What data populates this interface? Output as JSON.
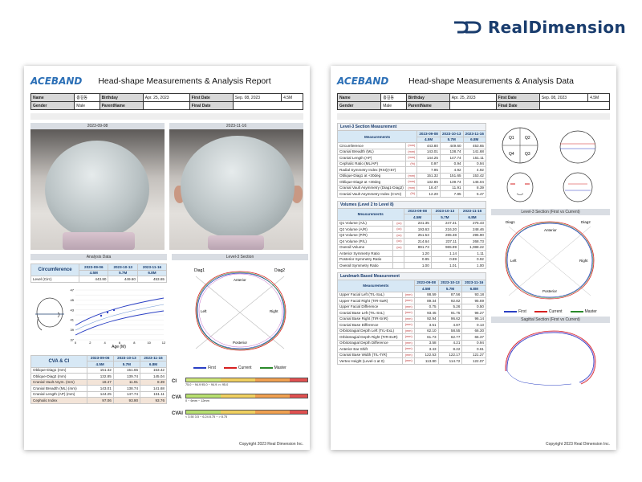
{
  "brand": {
    "name": "RealDimension",
    "accent": "#1a3d6e"
  },
  "left": {
    "logo": "ACEBAND",
    "title": "Head-shape Measurements & Analysis Report",
    "info": {
      "name_label": "Name",
      "name": "홍길동",
      "birthday_label": "Birthday",
      "birthday": "Apr. 25, 2023",
      "first_date_label": "First Date",
      "first_date": "Sep. 08, 2023",
      "age": "4.5M",
      "gender_label": "Gender",
      "gender": "Male",
      "parent_label": "ParentName",
      "final_label": "Final Date"
    },
    "photo_dates": [
      "2023-09-08",
      "2023-11-16"
    ],
    "analysis_label": "Analysis Data",
    "level3_label": "Level-3 Section",
    "circ": {
      "title": "Circumference",
      "dates": [
        "2023-09-06",
        "2023-10-13",
        "2023-11-16"
      ],
      "ages": [
        "4.5M",
        "5.7M",
        "6.8M"
      ],
      "row_label": "Level (Circ)",
      "values": [
        "443.80",
        "449.60",
        "453.65"
      ]
    },
    "growth": {
      "xlabel": "Age (M)",
      "yticks": [
        "47",
        "46",
        "45",
        "44",
        "43",
        "42",
        "41",
        "40",
        "39",
        "38",
        "37"
      ],
      "xticks": [
        "0",
        "2",
        "4",
        "6",
        "8",
        "10",
        "12"
      ]
    },
    "cva": {
      "title": "CVA & CI",
      "dates": [
        "2023-09-06",
        "2023-10-13",
        "2023-11-16"
      ],
      "ages": [
        "4.5M",
        "5.7M",
        "6.8M"
      ],
      "rows": [
        {
          "name": "Oblique-Diag1 (mm)",
          "v": [
            "151.32",
            "151.65",
            "153.42"
          ]
        },
        {
          "name": "Oblique-Diag2 (mm)",
          "v": [
            "132.85",
            "139.74",
            "145.04"
          ]
        },
        {
          "name": "Cranial Vault Asym. (mm)",
          "v": [
            "18.47",
            "11.91",
            "8.39"
          ],
          "hl": true
        },
        {
          "name": "Cranial Breadth (ML) (mm)",
          "v": [
            "143.01",
            "138.74",
            "141.68"
          ]
        },
        {
          "name": "Cranial Length (AP) (mm)",
          "v": [
            "144.25",
            "147.74",
            "151.11"
          ]
        },
        {
          "name": "Cephalic Index",
          "v": [
            "97.06",
            "93.90",
            "93.76"
          ],
          "hl": true
        }
      ]
    },
    "legend": [
      {
        "label": "First",
        "color": "#2a3fc4"
      },
      {
        "label": "Current",
        "color": "#d62020"
      },
      {
        "label": "Master",
        "color": "#2a8a2a"
      }
    ],
    "orient": {
      "d1": "Diag1",
      "d2": "Diag2",
      "ant": "Anterior",
      "post": "Posterior",
      "l": "Left",
      "r": "Right"
    },
    "scales": [
      {
        "label": "CI",
        "range_text": "75.0 ~ 94.9     95.0 ~ 94.9     >= 95.0"
      },
      {
        "label": "CVA",
        "range_text": "0 ~ 6mm     ~ 12mm"
      },
      {
        "label": "CVAI",
        "range_text": "< 3.50     3.5 ~ 6.24     8.75 ~     > 8.75"
      }
    ],
    "copyright": "Copyright 2023 Real Dimension Inc."
  },
  "right": {
    "logo": "ACEBAND",
    "title": "Head-shape Measurements & Analysis Data",
    "info": {
      "name_label": "Name",
      "name": "홍길동",
      "birthday_label": "Birthday",
      "birthday": "Apr. 25, 2023",
      "first_date_label": "First Date",
      "first_date": "Sep. 08, 2023",
      "age": "4.5M",
      "gender_label": "Gender",
      "gender": "Male",
      "parent_label": "ParentName",
      "final_label": "Final Date"
    },
    "meas_label": "Measurements",
    "dates": [
      "2023-09-08",
      "2023-10-13",
      "2023-11-16"
    ],
    "ages": [
      "4.5M",
      "5.7M",
      "6.8M"
    ],
    "sec1": {
      "title": "Level-3 Section Measurement",
      "rows": [
        {
          "n": "Circumference",
          "u": "(mm)",
          "v": [
            "443.80",
            "449.60",
            "453.65"
          ]
        },
        {
          "n": "Cranial Breadth (ML)",
          "u": "(mm)",
          "v": [
            "143.01",
            "138.74",
            "141.68"
          ]
        },
        {
          "n": "Cranial Length (AP)",
          "u": "(mm)",
          "v": [
            "144.25",
            "147.74",
            "151.11"
          ]
        },
        {
          "n": "Cephalic Ratio (ML/AP)",
          "u": "(%)",
          "v": [
            "0.97",
            "0.94",
            "0.94"
          ]
        },
        {
          "n": "Radial Symmetry Index (RSI)(<57)",
          "u": "",
          "v": [
            "7.95",
            "4.92",
            "4.92"
          ]
        },
        {
          "n": "Oblique-Diag1 at +30deg",
          "u": "(mm)",
          "v": [
            "151.32",
            "151.65",
            "153.42"
          ]
        },
        {
          "n": "Oblique-Diag2 at +30deg",
          "u": "(mm)",
          "v": [
            "132.85",
            "139.74",
            "145.04"
          ]
        },
        {
          "n": "Cranial Vault Asymmetry (Diag1-Diag2)",
          "u": "(mm)",
          "v": [
            "18.47",
            "11.91",
            "8.39"
          ]
        },
        {
          "n": "Cranial Vault Asymmetry Index (CVAI)",
          "u": "(%)",
          "v": [
            "12.20",
            "7.85",
            "5.47"
          ]
        }
      ]
    },
    "sec2": {
      "title": "Volumes (Level 2 to Level 8)",
      "rows": [
        {
          "n": "Q1 Volume (A/L)",
          "u": "(cc)",
          "v": [
            "231.35",
            "247.31",
            "275.43"
          ]
        },
        {
          "n": "Q2 Volume (A/R)",
          "u": "(cc)",
          "v": [
            "193.63",
            "216.20",
            "248.46"
          ]
        },
        {
          "n": "Q3 Volume (P/R)",
          "u": "(cc)",
          "v": [
            "251.53",
            "265.38",
            "295.90"
          ]
        },
        {
          "n": "Q4 Volume (P/L)",
          "u": "(cc)",
          "v": [
            "214.64",
            "237.11",
            "268.73"
          ]
        },
        {
          "n": "Overall Volume",
          "u": "(cc)",
          "v": [
            "891.73",
            "965.99",
            "1,088.22"
          ]
        },
        {
          "n": "Anterior Symmetry Ratio",
          "u": "",
          "v": [
            "1.20",
            "1.14",
            "1.11"
          ]
        },
        {
          "n": "Posterior Symmetry Ratio",
          "u": "",
          "v": [
            "0.85",
            "0.89",
            "0.92"
          ]
        },
        {
          "n": "Overall Symmetry Ratio",
          "u": "",
          "v": [
            "1.00",
            "1.01",
            "1.00"
          ]
        }
      ]
    },
    "sec3": {
      "title": "Landmark Based Measurement",
      "rows": [
        {
          "n": "Upper Facial Left (TrL-SaL)",
          "u": "(mm)",
          "v": [
            "88.59",
            "87.56",
            "93.18"
          ]
        },
        {
          "n": "Upper Facial Right (TrR-SaR)",
          "u": "(mm)",
          "v": [
            "89.34",
            "92.82",
            "95.69"
          ]
        },
        {
          "n": "Upper Facial Difference",
          "u": "(mm)",
          "v": [
            "0.75",
            "5.26",
            "0.50"
          ]
        },
        {
          "n": "Cranial Base Left (TrL-SnL)",
          "u": "(mm)",
          "v": [
            "93.45",
            "91.75",
            "96.27"
          ]
        },
        {
          "n": "Cranial Base Right (TrR-SnR)",
          "u": "(mm)",
          "v": [
            "92.94",
            "96.62",
            "96.14"
          ]
        },
        {
          "n": "Cranial Base Difference",
          "u": "(mm)",
          "v": [
            "3.51",
            "4.87",
            "0.13"
          ]
        },
        {
          "n": "Orbitotragial Depth Left (TrL-ExL)",
          "u": "(mm)",
          "v": [
            "62.10",
            "58.55",
            "66.30"
          ]
        },
        {
          "n": "Orbitotragial Depth Right (TrR-ExR)",
          "u": "(mm)",
          "v": [
            "61.73",
            "62.77",
            "65.37"
          ]
        },
        {
          "n": "Orbitotragial Depth Difference",
          "u": "(mm)",
          "v": [
            "3.58",
            "4.21",
            "0.94"
          ]
        },
        {
          "n": "Anterior Ear Shift",
          "u": "(mm)",
          "v": [
            "3.43",
            "8.22",
            "0.61"
          ]
        },
        {
          "n": "Cranial Base Width (TrL-TrR)",
          "u": "(mm)",
          "v": [
            "122.53",
            "122.17",
            "121.27"
          ]
        },
        {
          "n": "Vertex Height (Level-1 at 0)",
          "u": "(mm)",
          "v": [
            "113.80",
            "114.72",
            "122.07"
          ]
        }
      ]
    },
    "quad": {
      "q1": "Q1",
      "q2": "Q2",
      "q3": "Q3",
      "q4": "Q4"
    },
    "level3_label": "Level-3 Section (First vs Current)",
    "sagittal_label": "Sagittal Section (First vs Current)",
    "legend": [
      {
        "label": "First",
        "color": "#2a3fc4"
      },
      {
        "label": "Current",
        "color": "#d62020"
      },
      {
        "label": "Master",
        "color": "#2a8a2a"
      }
    ],
    "orient": {
      "d1": "Diag1",
      "d2": "Diag2",
      "ant": "Anterior",
      "post": "Posterior",
      "l": "Left",
      "r": "Right"
    },
    "copyright": "Copyright 2023 Real Dimension Inc."
  }
}
